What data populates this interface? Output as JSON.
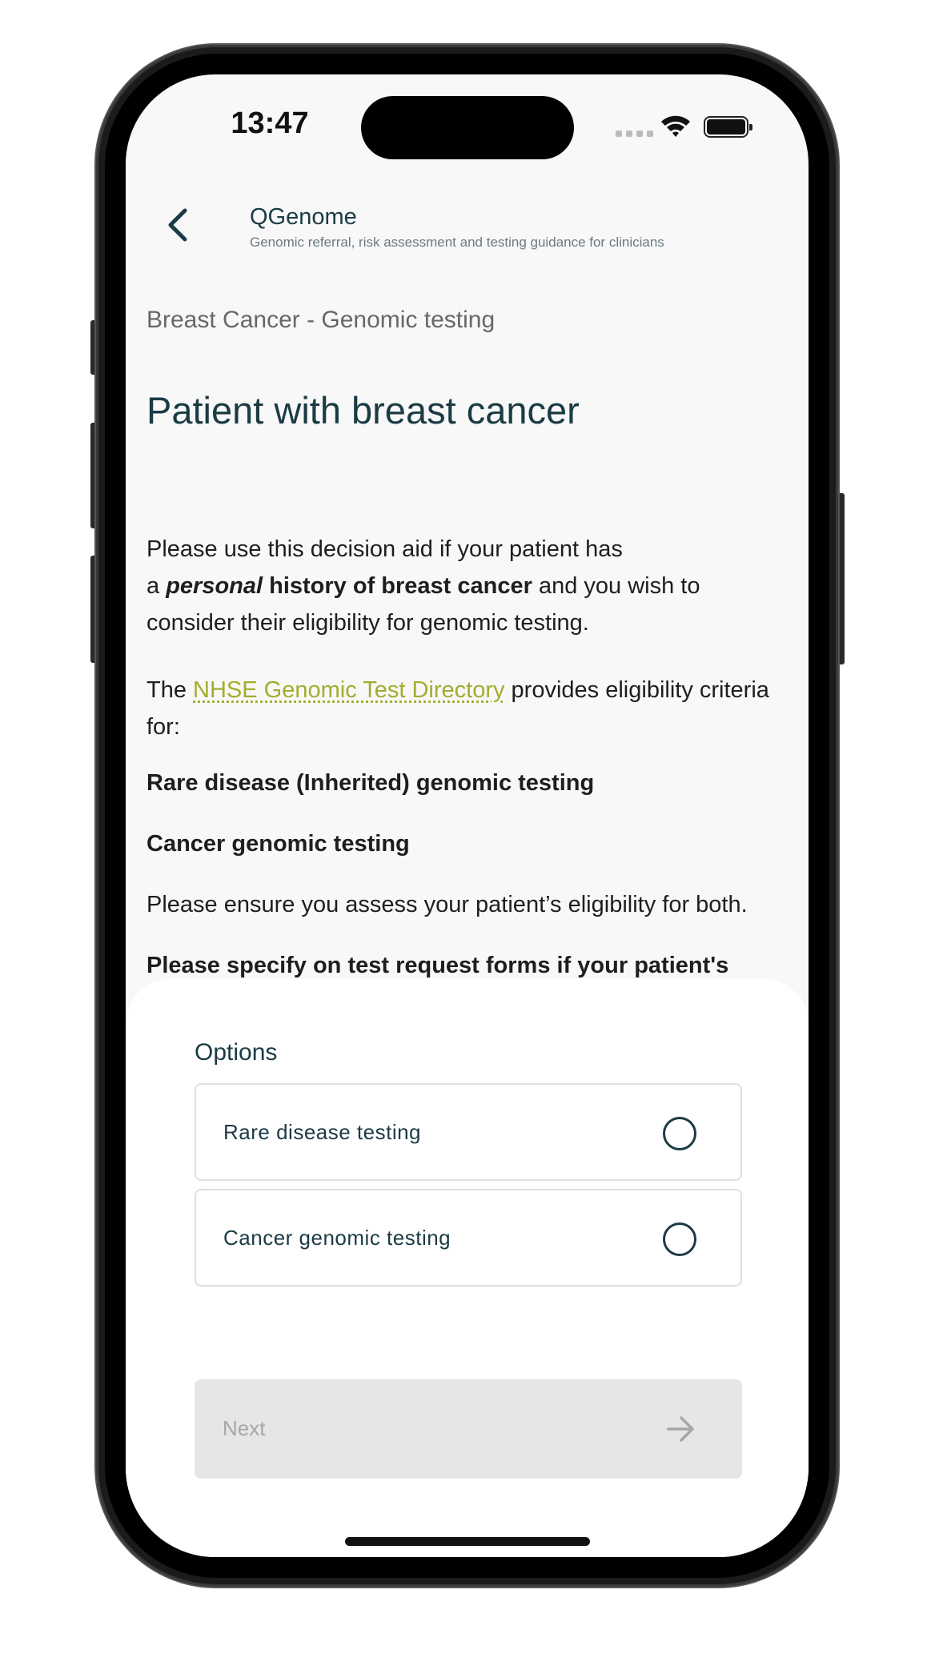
{
  "status_bar": {
    "time": "13:47"
  },
  "header": {
    "title": "QGenome",
    "subtitle": "Genomic referral, risk assessment and testing guidance for clinicians"
  },
  "breadcrumb": "Breast Cancer - Genomic testing",
  "page_title": "Patient with breast cancer",
  "intro": {
    "line1": "Please use this decision aid if your patient has",
    "a": "a ",
    "personal": "personal",
    "history": " history of breast cancer",
    "rest": " and you wish to consider their eligibility for genomic testing."
  },
  "directory": {
    "prefix": "The ",
    "link": "NHSE Genomic Test Directory",
    "suffix": " provides eligibility criteria for:"
  },
  "criteria": {
    "rare": "Rare disease (Inherited) genomic testing",
    "cancer": "Cancer genomic testing"
  },
  "ensure_text": "Please ensure you assess your patient’s eligibility for both.",
  "urgent_text": "Please specify on test request forms if your patient's results are required urgently.",
  "options": {
    "label": "Options",
    "items": [
      {
        "label": "Rare disease testing",
        "selected": false
      },
      {
        "label": "Cancer genomic testing",
        "selected": false
      }
    ]
  },
  "next_button": {
    "label": "Next",
    "enabled": false
  },
  "colors": {
    "primary": "#1b3b45",
    "link": "#a2ad2c",
    "disabled_bg": "#e6e6e6",
    "disabled_text": "#a7a7a7"
  }
}
